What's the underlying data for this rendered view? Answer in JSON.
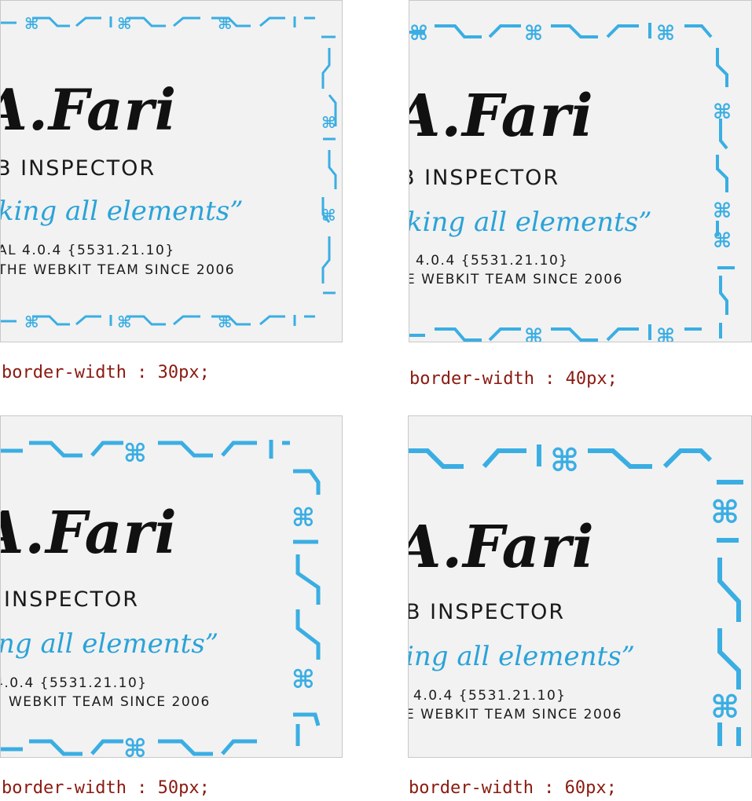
{
  "card": {
    "name": "A.Fari",
    "role_lines": [
      "B INSPECTOR",
      "B INSPECTOR",
      "INSPECTOR",
      "B INSPECTOR"
    ],
    "tagline_lines": [
      "king all elements”",
      "king all elements”",
      "ng all elements”",
      "ing all elements”"
    ],
    "version_lines": [
      "AL 4.0.4 {5531.21.10}",
      "4.0.4 {5531.21.10}",
      "4.0.4 {5531.21.10}",
      "4.0.4 {5531.21.10}"
    ],
    "team_lines": [
      "THE WEBKIT TEAM SINCE 2006",
      "E WEBKIT TEAM SINCE 2006",
      "WEBKIT TEAM SINCE 2006",
      "E WEBKIT TEAM SINCE 2006"
    ]
  },
  "captions": [
    "border-width : 30px;",
    "border-width : 40px;",
    "border-width : 50px;",
    "border-width : 60px;"
  ],
  "colors": {
    "accent": "#3aaee3",
    "tagline": "#2aa3d8",
    "caption": "#8a1a10",
    "panel_bg": "#f2f2f2"
  },
  "icons": [
    "command-icon"
  ]
}
